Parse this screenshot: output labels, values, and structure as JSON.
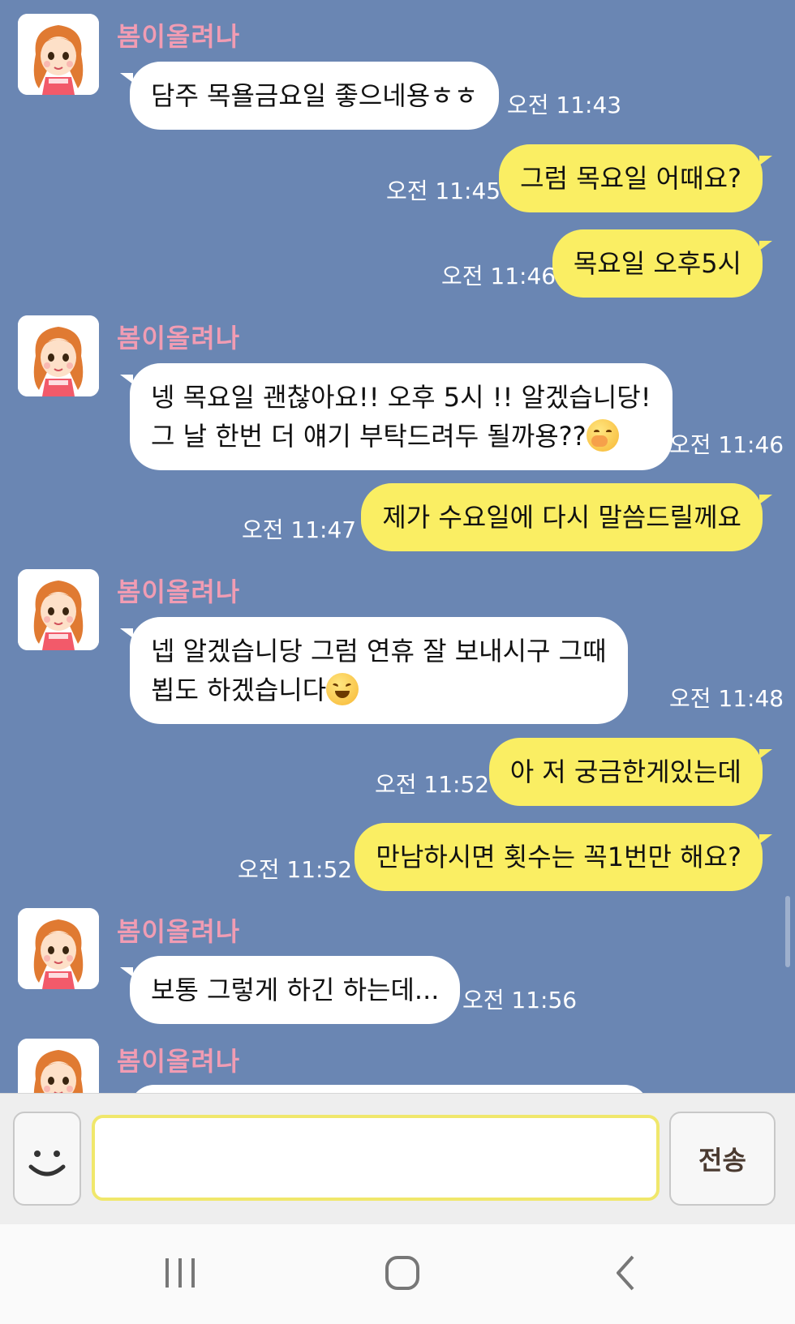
{
  "chat": {
    "sender_name": "봄이올려나",
    "messages": [
      {
        "id": "m1",
        "from": "in",
        "lines": [
          "담주 목욜금요일 좋으네용ㅎㅎ"
        ],
        "time": "오전 11:43"
      },
      {
        "id": "m2",
        "from": "out",
        "lines": [
          "그럼 목요일 어때요?"
        ],
        "time": "오전 11:45"
      },
      {
        "id": "m3",
        "from": "out",
        "lines": [
          "목요일 오후5시"
        ],
        "time": "오전 11:46"
      },
      {
        "id": "m4",
        "from": "in",
        "lines": [
          "넹 목요일 괜찮아요!! 오후 5시 !! 알겠습니당!",
          "그 날 한번 더 얘기 부탁드려두 될까용??"
        ],
        "emoji": "face-with-hand-over-mouth",
        "time": "오전 11:46"
      },
      {
        "id": "m5",
        "from": "out",
        "lines": [
          "제가 수요일에 다시 말씀드릴께요"
        ],
        "time": "오전 11:47"
      },
      {
        "id": "m6",
        "from": "in",
        "lines": [
          "넵 알겠습니당 그럼 연휴 잘 보내시구 그때",
          "뵙도 하겠습니다"
        ],
        "emoji": "grinning-squinting-face",
        "time": "오전 11:48"
      },
      {
        "id": "m7",
        "from": "out",
        "lines": [
          "아 저 궁금한게있는데"
        ],
        "time": "오전 11:52"
      },
      {
        "id": "m8",
        "from": "out",
        "lines": [
          "만남하시면 횟수는 꼭1번만 해요?"
        ],
        "time": "오전 11:52"
      },
      {
        "id": "m9",
        "from": "in",
        "lines": [
          "보통 그렇게 하긴 하는데..."
        ],
        "time": "오전 11:56"
      }
    ]
  },
  "input": {
    "value": "",
    "send_label": "전송",
    "emoji_icon": "smiley-icon"
  },
  "navbar": {
    "icons": [
      "recent-apps-icon",
      "home-icon",
      "back-icon"
    ]
  },
  "colors": {
    "chat_bg": "#6a86b3",
    "bubble_in": "#ffffff",
    "bubble_out": "#faee63",
    "sender_name": "#f19cb3",
    "input_border": "#f0e76b"
  }
}
